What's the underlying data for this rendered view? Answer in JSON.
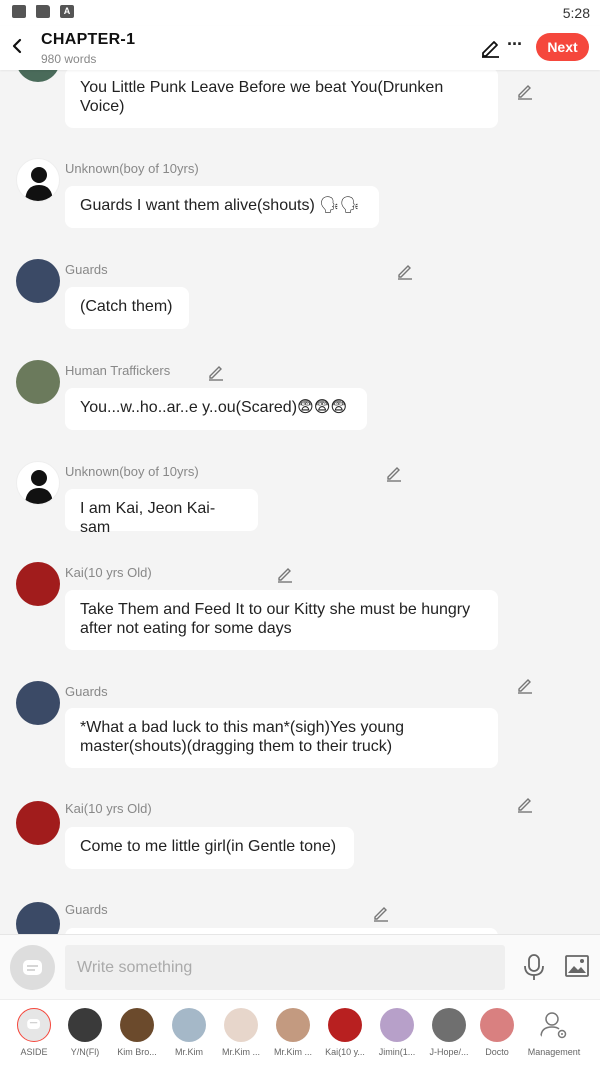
{
  "status": {
    "time": "5:28"
  },
  "header": {
    "title": "CHAPTER-1",
    "word_count": "980 words",
    "next_label": "Next"
  },
  "messages": [
    {
      "speaker": "",
      "text": "You Little Punk Leave Before we beat You(Drunken Voice)"
    },
    {
      "speaker": "Unknown(boy of 10yrs)",
      "text": "Guards I want them alive(shouts) 🗣🗣"
    },
    {
      "speaker": "Guards",
      "text": "(Catch them)"
    },
    {
      "speaker": "Human Traffickers",
      "text": "You...w..ho..ar..e y..ou(Scared)😨😨😨"
    },
    {
      "speaker": "Unknown(boy of 10yrs)",
      "text": "I am Kai, Jeon Kai-sam"
    },
    {
      "speaker": "Kai(10 yrs Old)",
      "text": "Take Them and Feed It to our Kitty she must be hungry after not eating for some days"
    },
    {
      "speaker": "Guards",
      "text": "*What a bad luck to this man*(sigh)Yes young master(shouts)(dragging them to their truck)"
    },
    {
      "speaker": "Kai(10 yrs Old)",
      "text": "Come to me little girl(in Gentle tone)"
    },
    {
      "speaker": "Guards",
      "text": ""
    }
  ],
  "composer": {
    "placeholder": "Write something"
  },
  "characters": [
    {
      "label": "ASIDE",
      "color": "#e0e0e0"
    },
    {
      "label": "Y/N(Fl)",
      "color": "#3a3a3a"
    },
    {
      "label": "Kim Bro...",
      "color": "#6b4a2c"
    },
    {
      "label": "Mr.Kim",
      "color": "#a5b8c8"
    },
    {
      "label": "Mr.Kim ...",
      "color": "#e7d6cb"
    },
    {
      "label": "Mr.Kim ...",
      "color": "#c39a80"
    },
    {
      "label": "Kai(10 y...",
      "color": "#b82020"
    },
    {
      "label": "Jimin(1...",
      "color": "#b7a0c9"
    },
    {
      "label": "J-Hope/...",
      "color": "#6f6f6f"
    },
    {
      "label": "Docto",
      "color": "#d98080"
    },
    {
      "label": "Management",
      "color": "#ffffff"
    }
  ]
}
